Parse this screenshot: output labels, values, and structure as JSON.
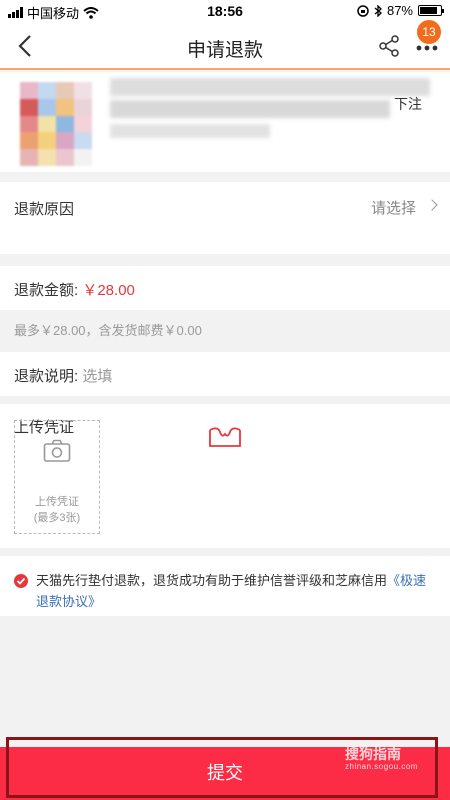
{
  "status_bar": {
    "carrier": "中国移动",
    "time": "18:56",
    "battery": "87%",
    "battery_level": 0.87
  },
  "nav": {
    "title": "申请退款",
    "badge_count": "13",
    "icons": [
      "back-icon",
      "share-icon",
      "more-icon"
    ]
  },
  "product": {
    "quantity_label": "下注"
  },
  "reason": {
    "label": "退款原因",
    "value": "请选择"
  },
  "amount": {
    "label": "退款金额:",
    "value": "￥28.00",
    "hint": "最多￥28.00，含发货邮费￥0.00"
  },
  "description": {
    "label": "退款说明:",
    "placeholder": "选填"
  },
  "upload": {
    "title": "上传凭证",
    "box_label": "上传凭证",
    "box_hint": "(最多3张)"
  },
  "agreement": {
    "text": "天猫先行垫付退款，退货成功有助于维护信誉评级和芝麻信用",
    "link": "《极速退款协议》"
  },
  "submit": {
    "label": "提交"
  },
  "watermark": {
    "line1": "搜狗指南",
    "line2": "zhinan.sogou.com"
  },
  "colors": {
    "accent": "#fd2c46",
    "price": "#e4393c",
    "link": "#3a6fb3",
    "badge": "#f26c1e"
  }
}
